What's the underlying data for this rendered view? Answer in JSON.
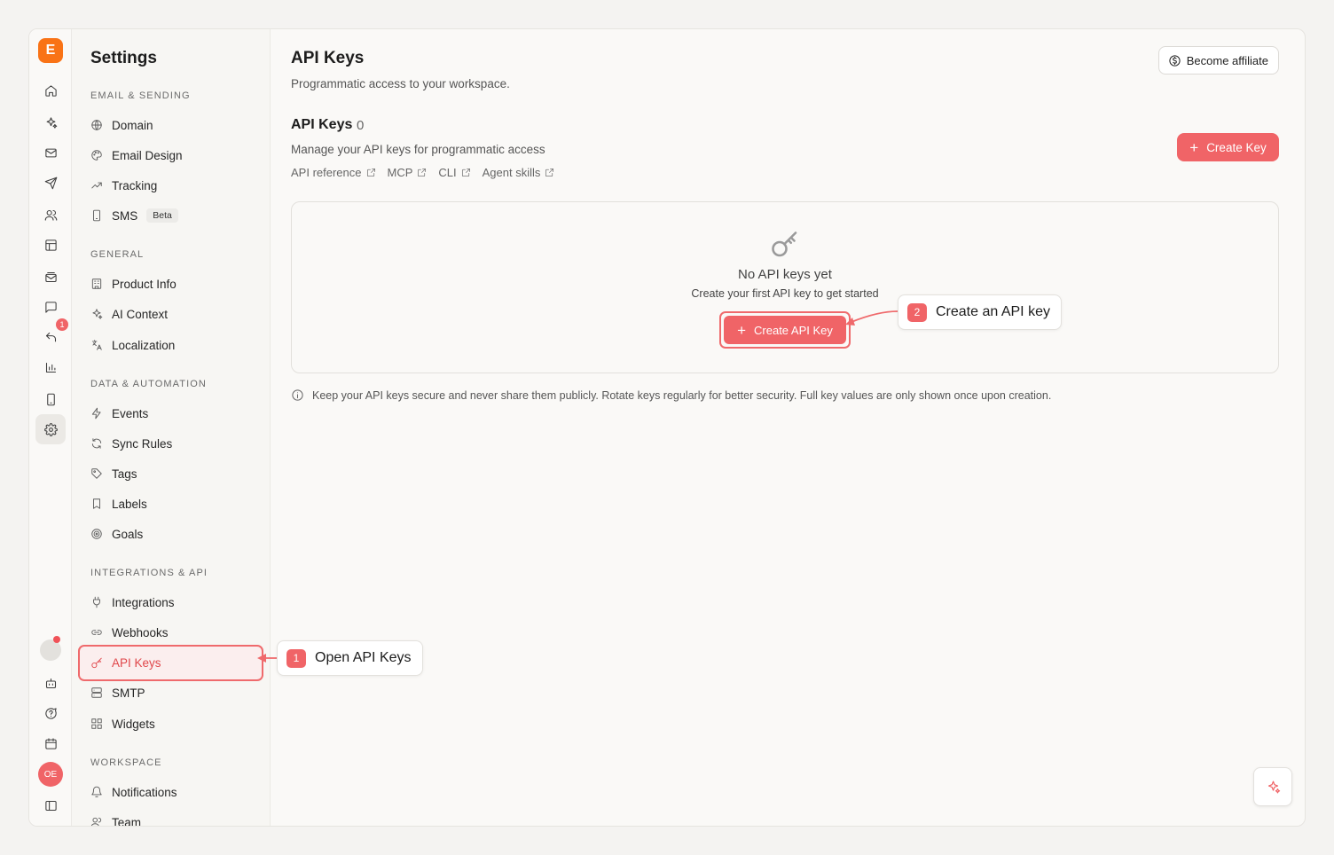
{
  "app": {
    "logo_letter": "E",
    "accent_color": "#f06467",
    "brand_color": "#f97316"
  },
  "rail": {
    "items": [
      {
        "icon": "home-icon"
      },
      {
        "icon": "sparkles-icon"
      },
      {
        "icon": "mail-icon"
      },
      {
        "icon": "send-icon"
      },
      {
        "icon": "users-icon"
      },
      {
        "icon": "layout-icon"
      },
      {
        "icon": "mail-stack-icon"
      },
      {
        "icon": "chat-icon"
      },
      {
        "icon": "reply-icon"
      },
      {
        "icon": "bar-chart-icon"
      },
      {
        "icon": "smartphone-icon"
      },
      {
        "icon": "settings-icon"
      }
    ],
    "reply_badge": "1",
    "bottom_items": [
      {
        "icon": "bot-icon"
      },
      {
        "icon": "help-icon"
      },
      {
        "icon": "calendar-icon"
      },
      {
        "icon": "sidebar-toggle-icon"
      }
    ],
    "avatar_initials": "OE"
  },
  "sidebar": {
    "title": "Settings",
    "sections": [
      {
        "label": "EMAIL & SENDING",
        "items": [
          {
            "label": "Domain",
            "icon": "globe-icon"
          },
          {
            "label": "Email Design",
            "icon": "palette-icon"
          },
          {
            "label": "Tracking",
            "icon": "trending-up-icon"
          },
          {
            "label": "SMS",
            "icon": "smartphone-icon",
            "badge": "Beta"
          }
        ]
      },
      {
        "label": "GENERAL",
        "items": [
          {
            "label": "Product Info",
            "icon": "building-icon"
          },
          {
            "label": "AI Context",
            "icon": "sparkles-icon"
          },
          {
            "label": "Localization",
            "icon": "languages-icon"
          }
        ]
      },
      {
        "label": "DATA & AUTOMATION",
        "items": [
          {
            "label": "Events",
            "icon": "zap-icon"
          },
          {
            "label": "Sync Rules",
            "icon": "refresh-icon"
          },
          {
            "label": "Tags",
            "icon": "tag-icon"
          },
          {
            "label": "Labels",
            "icon": "bookmark-icon"
          },
          {
            "label": "Goals",
            "icon": "target-icon"
          }
        ]
      },
      {
        "label": "INTEGRATIONS & API",
        "items": [
          {
            "label": "Integrations",
            "icon": "plug-icon"
          },
          {
            "label": "Webhooks",
            "icon": "link-icon"
          },
          {
            "label": "API Keys",
            "icon": "key-icon",
            "active": true
          },
          {
            "label": "SMTP",
            "icon": "server-icon"
          },
          {
            "label": "Widgets",
            "icon": "grid-icon"
          }
        ]
      },
      {
        "label": "WORKSPACE",
        "items": [
          {
            "label": "Notifications",
            "icon": "bell-icon"
          },
          {
            "label": "Team",
            "icon": "users-icon"
          }
        ]
      }
    ]
  },
  "main": {
    "title": "API Keys",
    "subtitle": "Programmatic access to your workspace.",
    "affiliate_label": "Become affiliate",
    "keys_heading": "API Keys",
    "keys_count": "0",
    "keys_description": "Manage your API keys for programmatic access",
    "links": [
      "API reference",
      "MCP",
      "CLI",
      "Agent skills"
    ],
    "create_key_label": "Create Key",
    "empty_state": {
      "title": "No API keys yet",
      "subtitle": "Create your first API key to get started",
      "button_label": "Create API Key"
    },
    "security_note": "Keep your API keys secure and never share them publicly. Rotate keys regularly for better security. Full key values are only shown once upon creation."
  },
  "callouts": [
    {
      "number": "1",
      "text": "Open API Keys"
    },
    {
      "number": "2",
      "text": "Create an API key"
    }
  ]
}
